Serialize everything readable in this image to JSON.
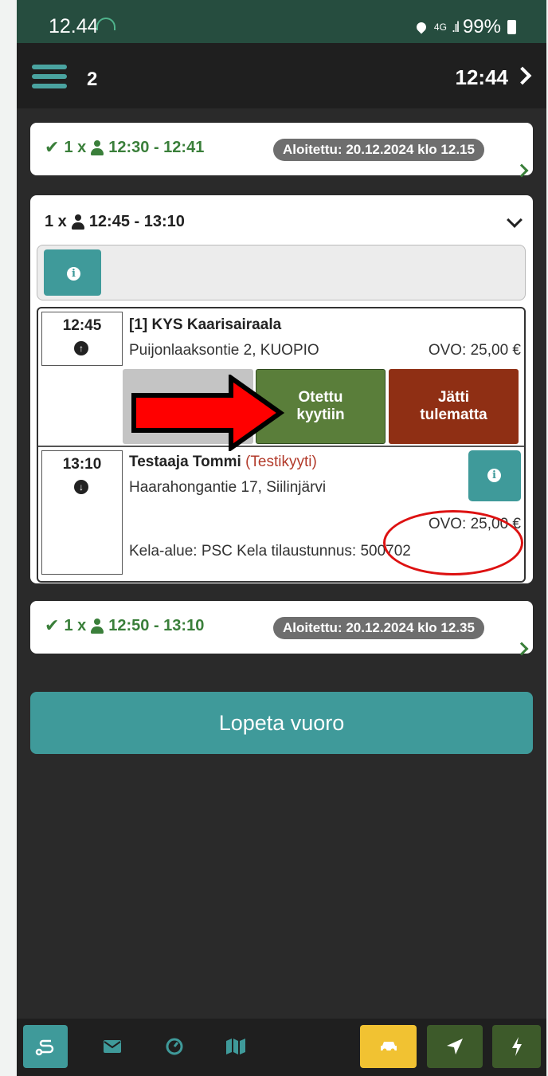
{
  "status_bar": {
    "time": "12.44",
    "network": "4G",
    "battery": "99%"
  },
  "header": {
    "trip_count": "2",
    "clock": "12:44"
  },
  "trips_done": [
    {
      "count": "1 x",
      "time_range": "12:30 - 12:41",
      "started": "Aloitettu: 20.12.2024 klo 12.15"
    },
    {
      "count": "1 x",
      "time_range": "12:50 - 13:10",
      "started": "Aloitettu: 20.12.2024 klo 12.35"
    }
  ],
  "active_trip": {
    "count": "1 x",
    "time_range": "12:45 - 13:10",
    "stops": [
      {
        "time": "12:45",
        "title": "[1] KYS Kaarisairaala",
        "address": "Puijonlaaksontie 2, KUOPIO",
        "ovo": "OVO: 25,00 €",
        "buttons": {
          "picked_up": "Otettu kyytiin",
          "no_show": "Jätti tulematta"
        }
      },
      {
        "time": "13:10",
        "name": "Testaaja Tommi",
        "tag": "(Testikyyti)",
        "address": "Haarahongantie 17, Siilinjärvi",
        "ovo": "OVO: 25,00 €",
        "kela": "Kela-alue: PSC Kela tilaustunnus: 500702"
      }
    ]
  },
  "end_shift_label": "Lopeta vuoro",
  "icons": {
    "menu": "hamburger-icon",
    "route": "route-icon",
    "mail": "envelope-icon",
    "speed": "speedometer-icon",
    "map": "map-icon",
    "car": "car-icon",
    "location": "location-arrow-icon",
    "bolt": "bolt-icon"
  },
  "colors": {
    "accent": "#3f9a9a",
    "green": "#5a7e3a",
    "red": "#8f2f14",
    "yellow": "#f1c232",
    "done_green": "#3a7f3a"
  }
}
